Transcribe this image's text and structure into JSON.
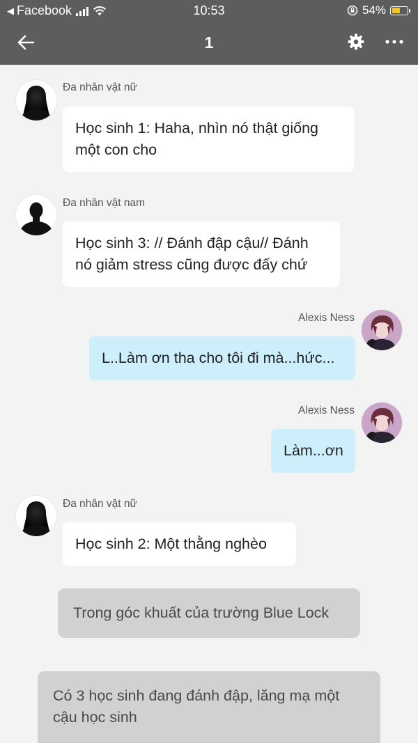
{
  "status_bar": {
    "back_app": "Facebook",
    "time": "10:53",
    "battery": "54%",
    "battery_level": 0.54,
    "battery_color": "#f5c518"
  },
  "nav": {
    "title": "1",
    "icons": [
      "back-arrow-icon",
      "gear-icon",
      "more-icon"
    ]
  },
  "messages": [
    {
      "side": "left",
      "sender": "Đa nhân vật nữ",
      "avatar": "female-silhouette",
      "line1": "Học sinh 1: Haha, nhìn nó thật giống",
      "line2": "một con cho"
    },
    {
      "side": "left",
      "sender": "Đa nhân vật nam",
      "avatar": "male-silhouette",
      "line1": "Học sinh 3: // Đánh đập cậu// Đánh",
      "line2": "nó giảm stress cũng được đấy chứ"
    },
    {
      "side": "right",
      "sender": "Alexis Ness",
      "avatar": "character-portrait",
      "line1": "L..Làm ơn tha cho tôi đi mà...hức..."
    },
    {
      "side": "right",
      "sender": "Alexis Ness",
      "avatar": "character-portrait",
      "line1": "Làm...ơn"
    },
    {
      "side": "left",
      "sender": "Đa nhân vật nữ",
      "avatar": "female-silhouette",
      "line1": "Học sinh 2: Một thằng nghèo"
    }
  ],
  "narrations": [
    {
      "line1": "Trong góc khuất của trường Blue Lock"
    },
    {
      "line1": "Có 3 học sinh đang đánh đập, lăng mạ một",
      "line2": "cậu học sinh"
    }
  ],
  "colors": {
    "header_bg": "#5d5d5d",
    "chat_bg": "#f3f3f3",
    "incoming_bubble": "#ffffff",
    "outgoing_bubble": "#cdeefb",
    "narration_bubble": "#d1d1d1"
  }
}
